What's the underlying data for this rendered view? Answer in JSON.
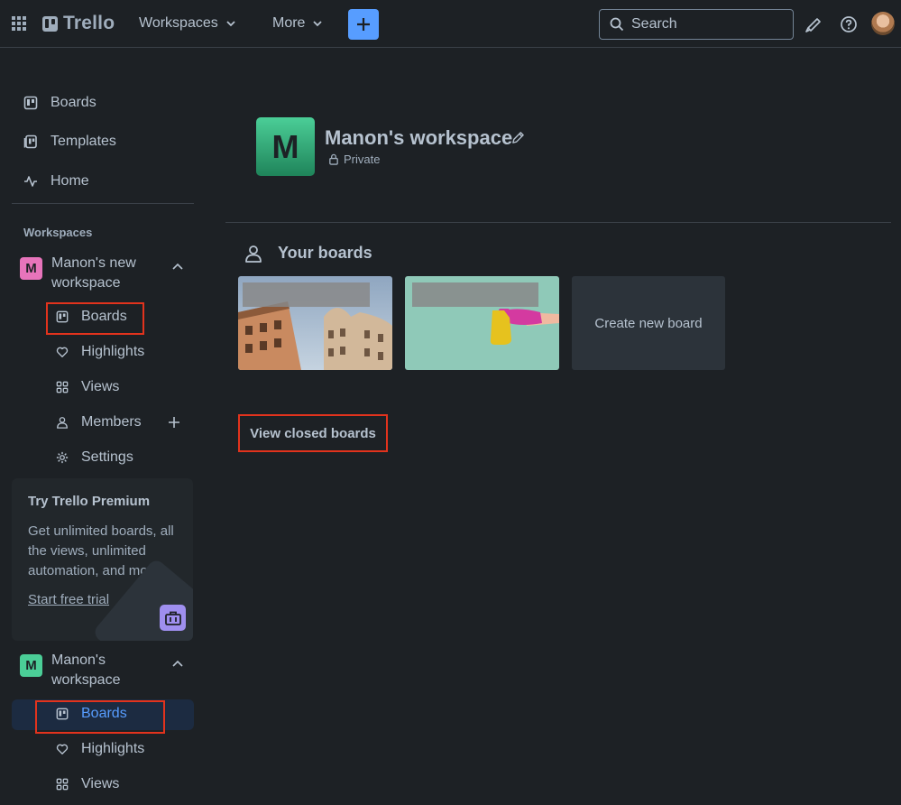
{
  "topbar": {
    "logo": "Trello",
    "workspaces_label": "Workspaces",
    "more_label": "More",
    "search_placeholder": "Search"
  },
  "sidebar": {
    "nav": [
      {
        "label": "Boards",
        "icon": "board-icon"
      },
      {
        "label": "Templates",
        "icon": "template-icon"
      },
      {
        "label": "Home",
        "icon": "activity-icon"
      }
    ],
    "section_label": "Workspaces",
    "workspace1": {
      "badge": "M",
      "name": "Manon's new workspace",
      "badge_color": "#e774bb",
      "items": [
        {
          "label": "Boards",
          "icon": "board-icon"
        },
        {
          "label": "Highlights",
          "icon": "heart-icon"
        },
        {
          "label": "Views",
          "icon": "grid-icon"
        },
        {
          "label": "Members",
          "icon": "members-icon"
        },
        {
          "label": "Settings",
          "icon": "gear-icon"
        }
      ]
    },
    "premium": {
      "title": "Try Trello Premium",
      "body": "Get unlimited boards, all the views, unlimited automation, and more.",
      "cta": "Start free trial"
    },
    "workspace2": {
      "badge": "M",
      "name": "Manon's workspace",
      "badge_color": "#4bce97",
      "items": [
        {
          "label": "Boards",
          "icon": "board-icon"
        },
        {
          "label": "Highlights",
          "icon": "heart-icon"
        },
        {
          "label": "Views",
          "icon": "grid-icon"
        }
      ]
    }
  },
  "main": {
    "workspace_badge": "M",
    "workspace_title": "Manon's workspace",
    "privacy": "Private",
    "your_boards_title": "Your boards",
    "create_board_label": "Create new board",
    "view_closed_label": "View closed boards"
  },
  "colors": {
    "background": "#1d2125",
    "accent": "#579dff",
    "highlight_box": "#e2331d"
  }
}
